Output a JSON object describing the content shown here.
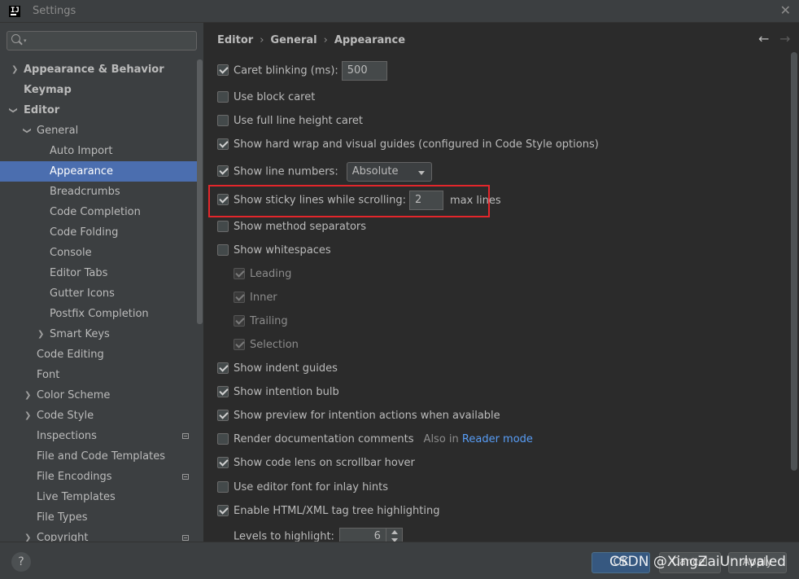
{
  "window": {
    "title": "Settings",
    "logo": "IJ"
  },
  "sidebar": {
    "search_placeholder": "",
    "items": [
      {
        "label": "Appearance & Behavior"
      },
      {
        "label": "Keymap"
      },
      {
        "label": "Editor"
      },
      {
        "label": "General"
      },
      {
        "label": "Auto Import"
      },
      {
        "label": "Appearance"
      },
      {
        "label": "Breadcrumbs"
      },
      {
        "label": "Code Completion"
      },
      {
        "label": "Code Folding"
      },
      {
        "label": "Console"
      },
      {
        "label": "Editor Tabs"
      },
      {
        "label": "Gutter Icons"
      },
      {
        "label": "Postfix Completion"
      },
      {
        "label": "Smart Keys"
      },
      {
        "label": "Code Editing"
      },
      {
        "label": "Font"
      },
      {
        "label": "Color Scheme"
      },
      {
        "label": "Code Style"
      },
      {
        "label": "Inspections"
      },
      {
        "label": "File and Code Templates"
      },
      {
        "label": "File Encodings"
      },
      {
        "label": "Live Templates"
      },
      {
        "label": "File Types"
      },
      {
        "label": "Copyright"
      }
    ]
  },
  "breadcrumb": {
    "items": [
      "Editor",
      "General",
      "Appearance"
    ],
    "separator": "›"
  },
  "nav": {
    "back": "←",
    "forward": "→"
  },
  "options": {
    "caret_blinking": {
      "label": "Caret blinking (ms):",
      "value": "500",
      "checked": true
    },
    "block_caret": {
      "label": "Use block caret"
    },
    "full_line_caret": {
      "label": "Use full line height caret"
    },
    "hard_wrap": {
      "label": "Show hard wrap and visual guides (configured in Code Style options)"
    },
    "line_numbers": {
      "label": "Show line numbers:",
      "value": "Absolute"
    },
    "sticky_lines": {
      "label": "Show sticky lines while scrolling:",
      "value": "2",
      "suffix": "max lines"
    },
    "method_separators": {
      "label": "Show method separators"
    },
    "whitespaces": {
      "label": "Show whitespaces"
    },
    "leading": {
      "label": "Leading"
    },
    "inner": {
      "label": "Inner"
    },
    "trailing": {
      "label": "Trailing"
    },
    "selection": {
      "label": "Selection"
    },
    "indent_guides": {
      "label": "Show indent guides"
    },
    "intention_bulb": {
      "label": "Show intention bulb"
    },
    "preview_intention": {
      "label": "Show preview for intention actions when available"
    },
    "render_docs": {
      "label": "Render documentation comments",
      "hint": "Also in",
      "link": "Reader mode"
    },
    "code_lens": {
      "label": "Show code lens on scrollbar hover"
    },
    "inlay_font": {
      "label": "Use editor font for inlay hints"
    },
    "tag_tree": {
      "label": "Enable HTML/XML tag tree highlighting"
    },
    "levels": {
      "label": "Levels to highlight:",
      "value": "6"
    }
  },
  "footer": {
    "help": "?",
    "ok": "OK",
    "cancel": "Cancel",
    "apply": "Apply"
  },
  "watermark": "CSDN @XingZaiUnrivaled",
  "colors": {
    "accent": "#4b6eaf",
    "highlight_box": "#e3262b",
    "link": "#589df6"
  }
}
